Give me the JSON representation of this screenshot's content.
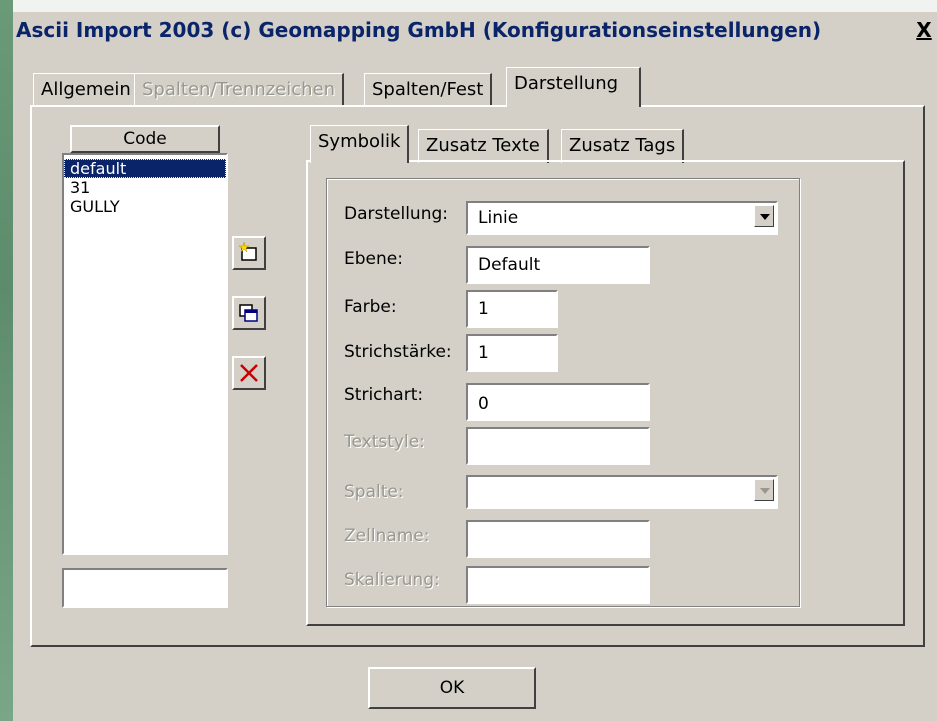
{
  "window": {
    "title": "Ascii Import 2003 (c) Geomapping GmbH (Konfigurationseinstellungen)",
    "close_label": "X"
  },
  "main_tabs": [
    {
      "label": "Allgemein",
      "state": "normal"
    },
    {
      "label": "Spalten/Trennzeichen",
      "state": "disabled"
    },
    {
      "label": "Spalten/Fest",
      "state": "normal"
    },
    {
      "label": "Darstellung",
      "state": "active"
    }
  ],
  "code_list": {
    "header": "Code",
    "items": [
      "default",
      "31",
      "GULLY"
    ],
    "selected": "default",
    "new_code_value": ""
  },
  "tools": {
    "new_icon": "new-item-icon",
    "copy_icon": "copy-icon",
    "delete_icon": "delete-x-icon",
    "delete_color": "#cc0000"
  },
  "sub_tabs": [
    {
      "label": "Symbolik",
      "state": "active"
    },
    {
      "label": "Zusatz Texte",
      "state": "normal"
    },
    {
      "label": "Zusatz Tags",
      "state": "normal"
    }
  ],
  "form": {
    "darstellung": {
      "label": "Darstellung:",
      "value": "Linie"
    },
    "ebene": {
      "label": "Ebene:",
      "value": "Default"
    },
    "farbe": {
      "label": "Farbe:",
      "value": "1"
    },
    "strichstaerke": {
      "label": "Strichstärke:",
      "value": "1"
    },
    "strichart": {
      "label": "Strichart:",
      "value": "0"
    },
    "textstyle": {
      "label": "Textstyle:",
      "value": ""
    },
    "spalte": {
      "label": "Spalte:",
      "value": ""
    },
    "zellname": {
      "label": "Zellname:",
      "value": ""
    },
    "skalierung": {
      "label": "Skalierung:",
      "value": ""
    }
  },
  "buttons": {
    "ok": "OK"
  },
  "colors": {
    "face": "#d4d0c8",
    "title_text": "#0a246a",
    "selection": "#0a246a"
  }
}
